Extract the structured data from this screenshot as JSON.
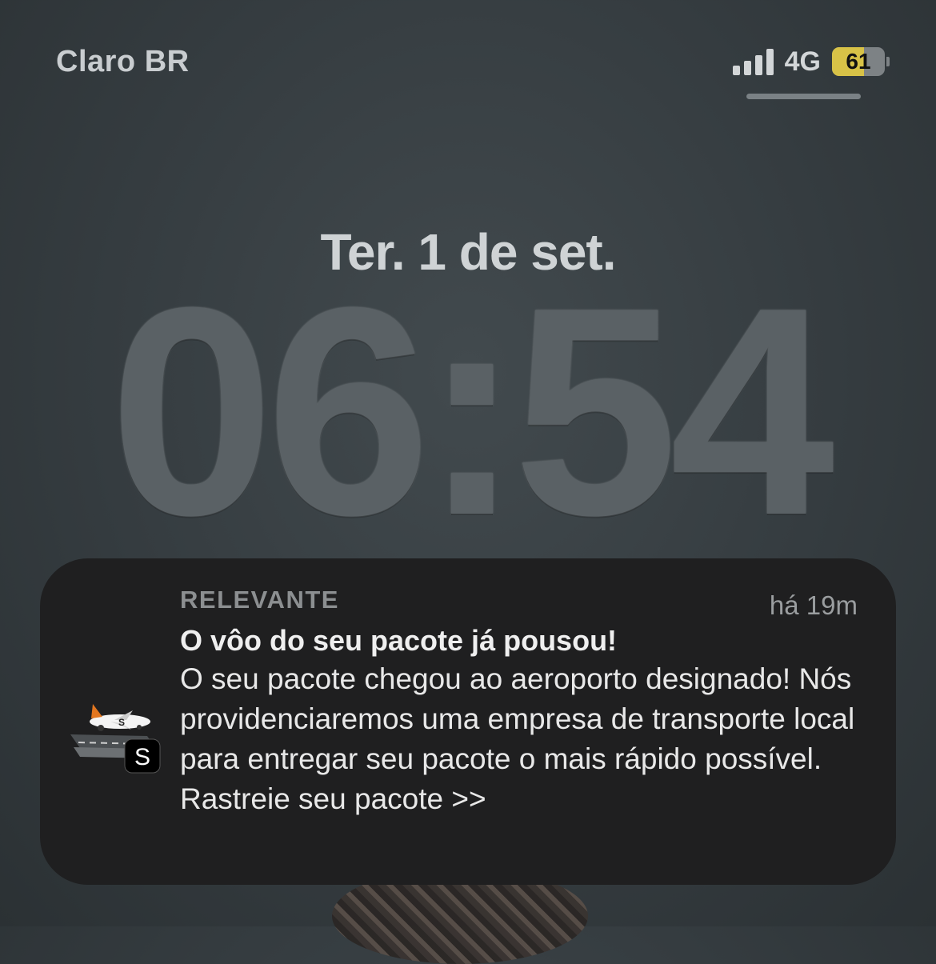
{
  "status_bar": {
    "carrier": "Claro BR",
    "network": "4G",
    "battery_percent": "61",
    "signal_bars": 4
  },
  "lock_screen": {
    "date": "Ter. 1 de set.",
    "time": "06:54"
  },
  "notification": {
    "category": "RELEVANTE",
    "time_ago": "há 19m",
    "title": "O vôo do seu pacote já pousou!",
    "body": "O seu pacote chegou ao aeroporto designado! Nós providenciaremos uma empresa de transporte local para entregar seu pacote o mais rápido possível. Rastreie seu pacote >>",
    "app_icon": "airplane-icon",
    "app_badge_letter": "S"
  },
  "colors": {
    "battery_fill": "#d8c247",
    "notification_bg": "#1f1f20"
  }
}
